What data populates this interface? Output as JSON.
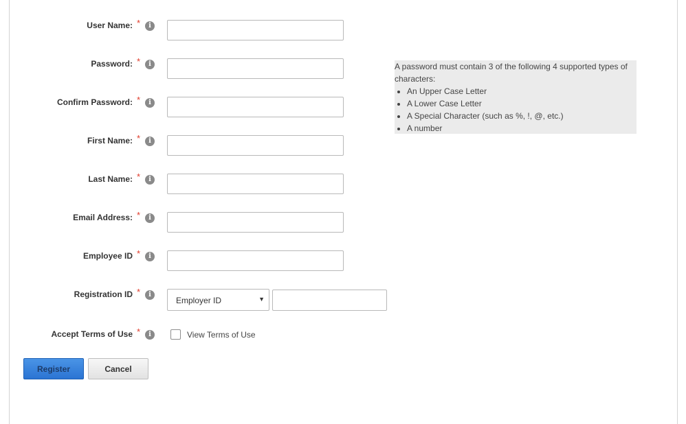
{
  "form": {
    "fields": [
      {
        "label": "User Name:",
        "required_mark": "*",
        "info_icon": "info-icon",
        "value": ""
      },
      {
        "label": "Password:",
        "required_mark": "*",
        "info_icon": "info-icon",
        "value": ""
      },
      {
        "label": "Confirm Password:",
        "required_mark": "*",
        "info_icon": "info-icon",
        "value": ""
      },
      {
        "label": "First Name:",
        "required_mark": "*",
        "info_icon": "info-icon",
        "value": ""
      },
      {
        "label": "Last Name:",
        "required_mark": "*",
        "info_icon": "info-icon",
        "value": ""
      },
      {
        "label": "Email Address:",
        "required_mark": "*",
        "info_icon": "info-icon",
        "value": ""
      },
      {
        "label": "Employee ID",
        "required_mark": "*",
        "info_icon": "info-icon",
        "value": ""
      }
    ],
    "registration": {
      "label": "Registration ID",
      "required_mark": "*",
      "select_value": "Employer ID",
      "id_value": ""
    },
    "terms": {
      "label": "Accept Terms of Use",
      "required_mark": "*",
      "checked": false,
      "link_text": "View Terms of Use"
    },
    "buttons": {
      "register": "Register",
      "cancel": "Cancel"
    }
  },
  "password_hint": {
    "intro": "A password must contain 3 of the following 4 supported types of characters:",
    "items": [
      "An Upper Case Letter",
      "A Lower Case Letter",
      "A Special Character (such as %, !, @, etc.)",
      "A number"
    ]
  },
  "colors": {
    "required": "#e03a2a",
    "primary_button": "#2b74d3",
    "hint_background": "#ebebeb"
  }
}
